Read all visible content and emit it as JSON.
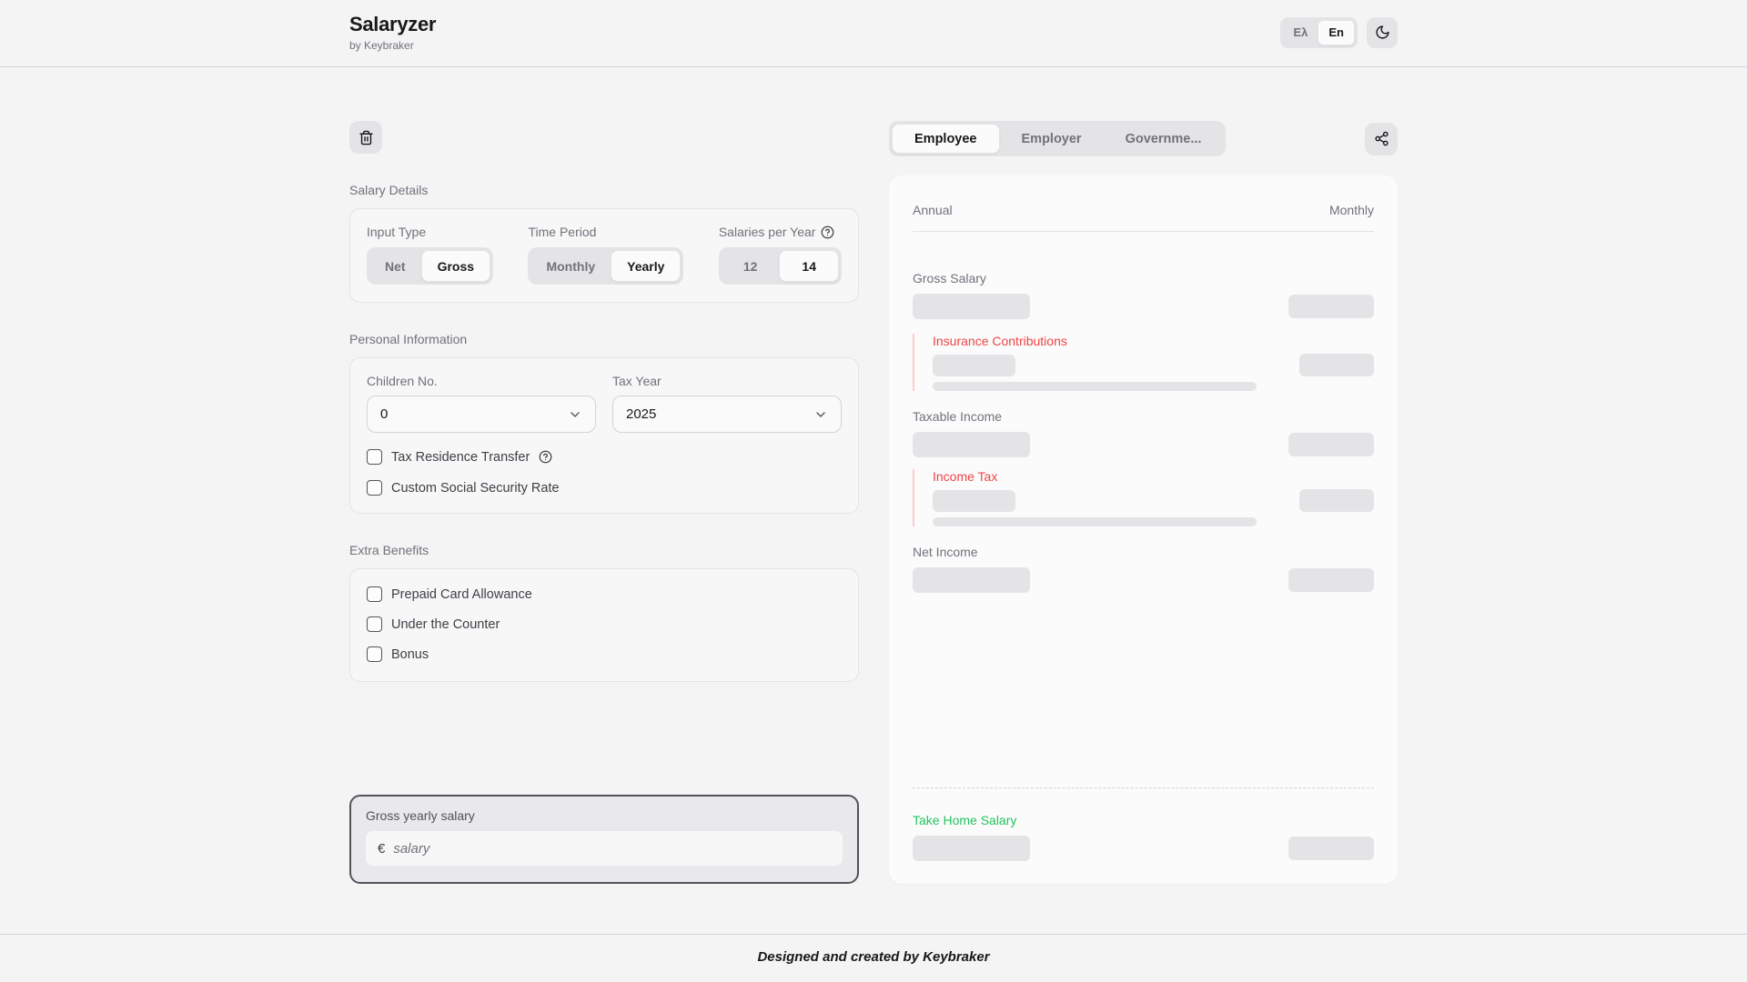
{
  "header": {
    "title": "Salaryzer",
    "subtitle": "by Keybraker",
    "languages": [
      "Ελ",
      "En"
    ],
    "active_language": "En"
  },
  "left": {
    "salary_details": {
      "heading": "Salary Details",
      "input_type": {
        "label": "Input Type",
        "options": [
          "Net",
          "Gross"
        ],
        "selected": "Gross"
      },
      "time_period": {
        "label": "Time Period",
        "options": [
          "Monthly",
          "Yearly"
        ],
        "selected": "Yearly"
      },
      "salaries_per_year": {
        "label": "Salaries per Year",
        "options": [
          "12",
          "14"
        ],
        "selected": "14"
      }
    },
    "personal_information": {
      "heading": "Personal Information",
      "children": {
        "label": "Children No.",
        "value": "0"
      },
      "tax_year": {
        "label": "Tax Year",
        "value": "2025"
      },
      "checkboxes": [
        {
          "label": "Tax Residence Transfer",
          "checked": false,
          "has_help": true
        },
        {
          "label": "Custom Social Security Rate",
          "checked": false,
          "has_help": false
        }
      ]
    },
    "extra_benefits": {
      "heading": "Extra Benefits",
      "checkboxes": [
        {
          "label": "Prepaid Card Allowance",
          "checked": false
        },
        {
          "label": "Under the Counter",
          "checked": false
        },
        {
          "label": "Bonus",
          "checked": false
        }
      ]
    },
    "salary_input": {
      "label": "Gross yearly salary",
      "currency": "€",
      "placeholder": "salary",
      "value": ""
    }
  },
  "results": {
    "tabs": [
      "Employee",
      "Employer",
      "Governme..."
    ],
    "active_tab": "Employee",
    "columns": {
      "left": "Annual",
      "right": "Monthly"
    },
    "rows": {
      "gross_salary": "Gross Salary",
      "insurance_contributions": "Insurance Contributions",
      "taxable_income": "Taxable Income",
      "income_tax": "Income Tax",
      "net_income": "Net Income",
      "take_home_salary": "Take Home Salary"
    },
    "values_loading": true
  },
  "footer": {
    "text": "Designed and created by Keybraker"
  },
  "icons": {
    "theme": "moon-icon",
    "clear": "trash-icon",
    "share": "share-icon",
    "help": "help-circle-icon",
    "select": "chevron-down-icon"
  },
  "colors": {
    "page-bg": "#f4f4f5",
    "control-bg": "#e4e4e7",
    "card-bg": "#fbfbfc",
    "accent-red": "#ef4444",
    "accent-red-border": "#fecaca",
    "accent-green": "#22c55e"
  }
}
